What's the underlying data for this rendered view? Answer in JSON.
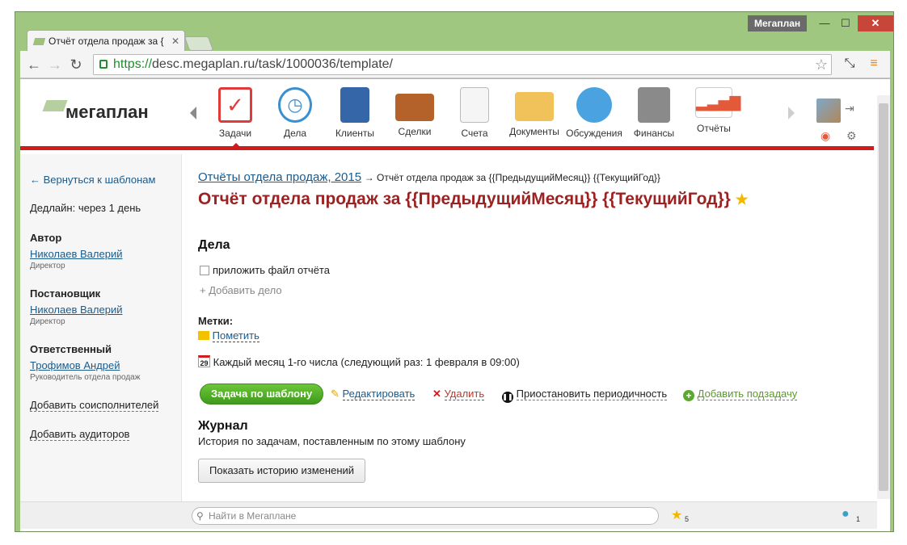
{
  "window": {
    "app_name": "Мегаплан",
    "tab_title": "Отчёт отдела продаж за {",
    "close_label": "✕",
    "min_label": "—",
    "max_label": "☐"
  },
  "browser": {
    "url_https": "https://",
    "url_rest": "desc.megaplan.ru/task/1000036/template/"
  },
  "logo": {
    "text": "мегаплан"
  },
  "nav": {
    "items": [
      {
        "label": "Задачи",
        "icon": "tasks-icon",
        "color": "#e03a3a"
      },
      {
        "label": "Дела",
        "icon": "clock-icon",
        "color": "#3a8fd0"
      },
      {
        "label": "Клиенты",
        "icon": "contacts-book-icon",
        "color": "#3567a8"
      },
      {
        "label": "Сделки",
        "icon": "briefcase-icon",
        "color": "#b4612a"
      },
      {
        "label": "Счета",
        "icon": "invoice-icon",
        "color": "#d9d9d9"
      },
      {
        "label": "Документы",
        "icon": "folder-icon",
        "color": "#f2c25a"
      },
      {
        "label": "Обсуждения",
        "icon": "chat-bubbles-icon",
        "color": "#4aa3e0"
      },
      {
        "label": "Финансы",
        "icon": "safe-icon",
        "color": "#8a8a8a"
      },
      {
        "label": "Отчёты",
        "icon": "report-chart-icon",
        "color": "#e35a3a"
      }
    ]
  },
  "sidebar": {
    "back_link": "← Вернуться к шаблонам",
    "deadline": "Дедлайн: через 1 день",
    "author_h": "Автор",
    "author_name": "Николаев Валерий",
    "author_role": "Директор",
    "setter_h": "Постановщик",
    "setter_name": "Николаев Валерий",
    "setter_role": "Директор",
    "resp_h": "Ответственный",
    "resp_name": "Трофимов Андрей",
    "resp_role": "Руководитель отдела продаж",
    "add_coexec": "Добавить соисполнителей",
    "add_auditors": "Добавить аудиторов"
  },
  "main": {
    "breadcrumb_link": "Отчёты отдела продаж, 2015",
    "breadcrumb_rest": "→ Отчёт отдела продаж за {{ПредыдущийМесяц}} {{ТекущийГод}}",
    "title": "Отчёт отдела продаж за {{ПредыдущийМесяц}} {{ТекущийГод}}",
    "deals_h": "Дела",
    "deal_item": "приложить файл отчёта",
    "add_deal": "+ Добавить дело",
    "tags_h": "Метки:",
    "tag_link": "Пометить",
    "schedule_day": "29",
    "schedule": "Каждый месяц 1-го числа (следующий раз: 1 февраля в 09:00)",
    "btn_task": "Задача по шаблону",
    "btn_edit": "Редактировать",
    "btn_delete": "Удалить",
    "btn_pause": "Приостановить периодичность",
    "btn_subtask": "Добавить подзадачу",
    "journal_h": "Журнал",
    "journal_sub": "История по задачам, поставленным по этому шаблону",
    "btn_history": "Показать историю изменений"
  },
  "footer": {
    "search_placeholder": "Найти в Мегаплане",
    "favorites_count": "5",
    "comments_count": "1"
  }
}
